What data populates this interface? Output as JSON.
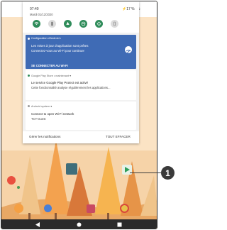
{
  "status_bar": {
    "time": "07:40",
    "battery": "⚡17 %",
    "date": "Mardi 01/12/2020"
  },
  "quick_settings": [
    {
      "icon": "wifi-icon",
      "state": "on"
    },
    {
      "icon": "vibrate-icon",
      "state": "off"
    },
    {
      "icon": "do-not-disturb-icon",
      "state": "on"
    },
    {
      "icon": "data-saver-icon",
      "state": "on"
    },
    {
      "icon": "rotate-icon",
      "state": "on"
    },
    {
      "icon": "flashlight-icon",
      "state": "off"
    }
  ],
  "notifications": [
    {
      "app": "Configuration d'Android •",
      "title": "Les mises à jour d'application sont prêtes",
      "text": "Connectez-vous au Wi-Fi pour continuer",
      "action": "SE CONNECTER AU WI-FI",
      "accent": "#3f6bb5"
    },
    {
      "app": "Google Play Store • maintenant ▾",
      "title": "Le service Google Play Protect est activé",
      "text": "Cette fonctionnalité analyse régulièrement les applications..."
    },
    {
      "app": "Android system ▾",
      "title": "Connect to open Wi-Fi network",
      "text": "TCT-Guest"
    }
  ],
  "shade_footer": {
    "manage": "Gérer les notifications",
    "clear": "TOUT EFFACER"
  },
  "callout": {
    "number": "1"
  },
  "colors": {
    "qs_on": "#2f8c5a",
    "notification_accent": "#3f6bb5",
    "nav_bar": "#2b2b2b"
  }
}
